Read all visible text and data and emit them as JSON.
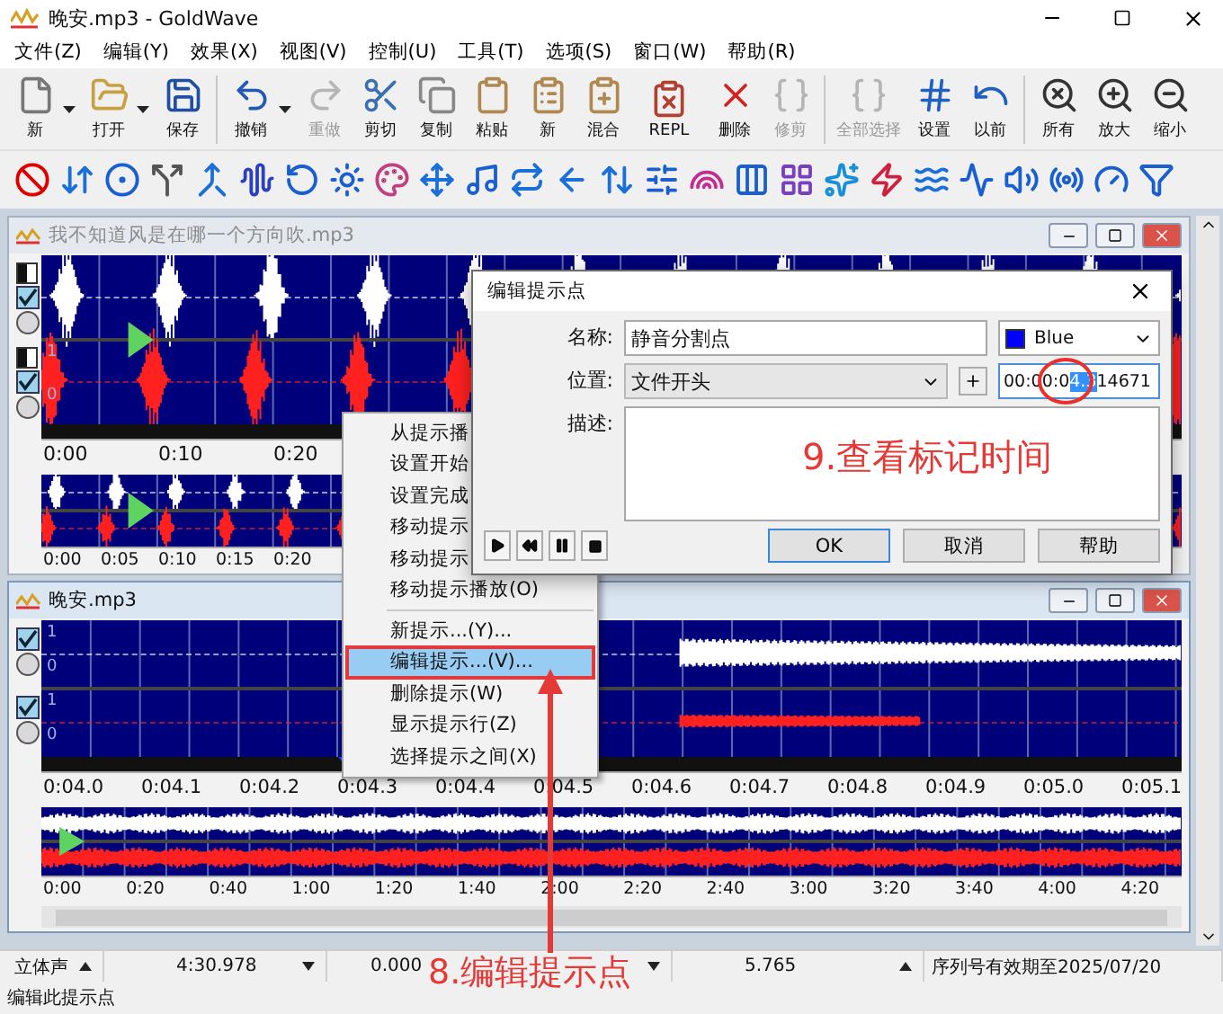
{
  "window": {
    "title": "晚安.mp3 - GoldWave"
  },
  "menu": [
    "文件(Z)",
    "编辑(Y)",
    "效果(X)",
    "视图(V)",
    "控制(U)",
    "工具(T)",
    "选项(S)",
    "窗口(W)",
    "帮助(R)"
  ],
  "toolbar": [
    {
      "label": "新",
      "disabled": false
    },
    {
      "label": "打开",
      "disabled": false
    },
    {
      "label": "保存",
      "disabled": false
    },
    {
      "label": "撤销",
      "disabled": false
    },
    {
      "label": "重做",
      "disabled": true
    },
    {
      "label": "剪切",
      "disabled": false
    },
    {
      "label": "复制",
      "disabled": false
    },
    {
      "label": "粘贴",
      "disabled": false
    },
    {
      "label": "新",
      "disabled": false
    },
    {
      "label": "混合",
      "disabled": false
    },
    {
      "label": "REPL",
      "disabled": false
    },
    {
      "label": "删除",
      "disabled": false
    },
    {
      "label": "修剪",
      "disabled": true
    },
    {
      "label": "全部选择",
      "disabled": true
    },
    {
      "label": "设置",
      "disabled": false
    },
    {
      "label": "以前",
      "disabled": false
    },
    {
      "label": "所有",
      "disabled": false
    },
    {
      "label": "放大",
      "disabled": false
    },
    {
      "label": "缩小",
      "disabled": false
    }
  ],
  "documents": [
    {
      "title": "我不知道风是在哪一个方向吹.mp3",
      "active": false,
      "kind": "speech",
      "channels": [
        {
          "checked": true,
          "selected": false
        },
        {
          "checked": true,
          "selected": false,
          "scale": [
            "1",
            "0"
          ]
        }
      ],
      "time_labels": [
        "0:00",
        "0:10",
        "0:20"
      ],
      "overview_labels": [
        "0:00",
        "0:05",
        "0:10",
        "0:15",
        "0:20"
      ]
    },
    {
      "title": "晚安.mp3",
      "active": true,
      "kind": "fade",
      "channels": [
        {
          "checked": true,
          "selected": false,
          "scale": [
            "1",
            "0"
          ]
        },
        {
          "checked": true,
          "selected": false,
          "scale": [
            "1",
            "0"
          ]
        }
      ],
      "time_labels": [
        "0:04.0",
        "0:04.1",
        "0:04.2",
        "0:04.3",
        "0:04.4",
        "0:04.5",
        "0:04.6",
        "0:04.7",
        "0:04.8",
        "0:04.9",
        "0:05.0",
        "0:05.1"
      ],
      "overview_labels": [
        "0:00",
        "0:20",
        "0:40",
        "1:00",
        "1:20",
        "1:40",
        "2:00",
        "2:20",
        "2:40",
        "3:00",
        "3:20",
        "3:40",
        "4:00",
        "4:20"
      ]
    }
  ],
  "context_menu": {
    "items": [
      {
        "label": "从提示播",
        "selected": false
      },
      {
        "label": "设置开始",
        "selected": false
      },
      {
        "label": "设置完成",
        "selected": false
      },
      {
        "label": "移动提示",
        "selected": false
      },
      {
        "label": "移动提示",
        "selected": false
      },
      {
        "label": "移动提示播放(O)",
        "selected": false
      },
      {
        "label": "新提示...(Y)...",
        "selected": false
      },
      {
        "label": "编辑提示...(V)...",
        "selected": true
      },
      {
        "label": "删除提示(W)",
        "selected": false
      },
      {
        "label": "显示提示行(Z)",
        "selected": false
      },
      {
        "label": "选择提示之间(X)",
        "selected": false
      }
    ]
  },
  "dialog": {
    "title": "编辑提示点",
    "name_label": "名称:",
    "name_value": "静音分割点",
    "cue_color": {
      "label": "Blue",
      "color": "#0000ff"
    },
    "position_label": "位置:",
    "position_value": "文件开头",
    "time": {
      "before": "00:00:0",
      "selected": "4.3",
      "after": "14671"
    },
    "description_label": "描述:",
    "buttons": [
      {
        "label": "OK",
        "default": true
      },
      {
        "label": "取消",
        "default": false
      },
      {
        "label": "帮助",
        "default": false
      }
    ]
  },
  "status_bar": {
    "cells": [
      "立体声",
      "4:30.978",
      "0.000",
      "5.765",
      "序列号有效期至2025/07/20"
    ],
    "hint": "编辑此提示点"
  },
  "annotations": [
    {
      "text": "9.查看标记时间"
    },
    {
      "text": "8.编辑提示点"
    }
  ]
}
